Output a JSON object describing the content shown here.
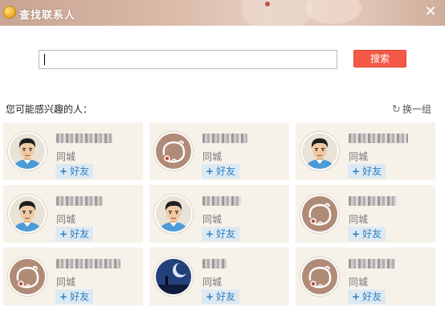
{
  "window": {
    "title": "查找联系人",
    "close_symbol": "✕",
    "accent_color": "#f25a47"
  },
  "search": {
    "value": "",
    "button_label": "搜索"
  },
  "suggestions": {
    "heading": "您可能感兴趣的人：",
    "refresh_label": "换一组",
    "people": [
      {
        "avatar": "boy-cartoon-avatar",
        "city": "同城",
        "add_label": "好友"
      },
      {
        "avatar": "default-avatar",
        "city": "同城",
        "add_label": "好友"
      },
      {
        "avatar": "boy-cartoon-avatar",
        "city": "同城",
        "add_label": "好友"
      },
      {
        "avatar": "boy-cartoon-avatar",
        "city": "同城",
        "add_label": "好友"
      },
      {
        "avatar": "boy-cartoon-avatar",
        "city": "同城",
        "add_label": "好友"
      },
      {
        "avatar": "default-avatar",
        "city": "同城",
        "add_label": "好友"
      },
      {
        "avatar": "default-avatar",
        "city": "同城",
        "add_label": "好友"
      },
      {
        "avatar": "night-moon-avatar",
        "city": "同城",
        "add_label": "好友"
      },
      {
        "avatar": "default-avatar",
        "city": "同城",
        "add_label": "好友"
      }
    ]
  }
}
